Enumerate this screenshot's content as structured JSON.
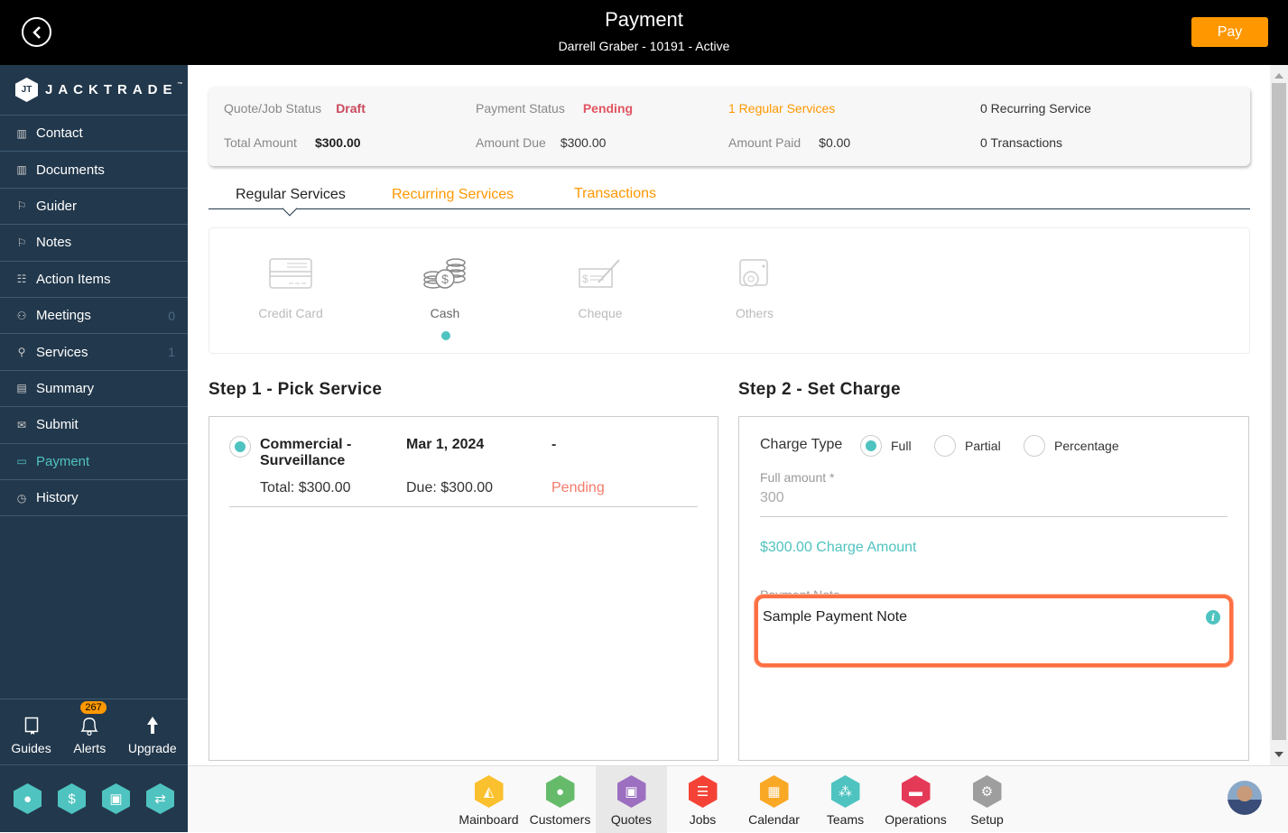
{
  "header": {
    "title": "Payment",
    "subtitle": "Darrell Graber - 10191 - Active",
    "pay_label": "Pay"
  },
  "brand": {
    "name": "JACKTRADE",
    "tm": "™"
  },
  "sidebar": {
    "items": [
      {
        "label": "Contact",
        "icon": "contact-book-icon"
      },
      {
        "label": "Documents",
        "icon": "document-book-icon"
      },
      {
        "label": "Guider",
        "icon": "signpost-icon"
      },
      {
        "label": "Notes",
        "icon": "signpost-icon"
      },
      {
        "label": "Action Items",
        "icon": "clipboard-icon"
      },
      {
        "label": "Meetings",
        "icon": "meeting-icon",
        "count": "0"
      },
      {
        "label": "Services",
        "icon": "services-icon",
        "count": "1"
      },
      {
        "label": "Summary",
        "icon": "summary-icon"
      },
      {
        "label": "Submit",
        "icon": "submit-icon"
      },
      {
        "label": "Payment",
        "icon": "payment-icon",
        "active": true
      },
      {
        "label": "History",
        "icon": "history-icon"
      }
    ],
    "tools": [
      {
        "label": "Guides"
      },
      {
        "label": "Alerts",
        "badge": "267"
      },
      {
        "label": "Upgrade"
      }
    ]
  },
  "summary": {
    "quote_status_label": "Quote/Job Status",
    "quote_status": "Draft",
    "payment_status_label": "Payment Status",
    "payment_status": "Pending",
    "regular_services": "1 Regular Services",
    "recurring_service": "0 Recurring Service",
    "total_label": "Total Amount",
    "total": "$300.00",
    "due_label": "Amount Due",
    "due": "$300.00",
    "paid_label": "Amount Paid",
    "paid": "$0.00",
    "transactions": "0 Transactions"
  },
  "tabs": [
    {
      "label": "Regular Services",
      "active": true
    },
    {
      "label": "Recurring Services"
    },
    {
      "label": "Transactions"
    }
  ],
  "methods": [
    {
      "label": "Credit Card"
    },
    {
      "label": "Cash",
      "selected": true
    },
    {
      "label": "Cheque"
    },
    {
      "label": "Others"
    }
  ],
  "step1": {
    "title": "Step 1 - Pick Service",
    "service": {
      "name": "Commercial - Surveillance",
      "date": "Mar 1, 2024",
      "extra": "-",
      "total": "Total: $300.00",
      "due": "Due: $300.00",
      "status": "Pending"
    }
  },
  "step2": {
    "title": "Step 2 - Set Charge",
    "charge_type_label": "Charge Type",
    "options": [
      "Full",
      "Partial",
      "Percentage"
    ],
    "selected": "Full",
    "full_amount_label": "Full amount *",
    "full_amount_value": "300",
    "charge_amount": "$300.00 Charge Amount",
    "note_label": "Payment Note",
    "note_value": "Sample Payment Note"
  },
  "apps": [
    {
      "label": "Mainboard",
      "color": "#fbc02d"
    },
    {
      "label": "Customers",
      "color": "#66bb6a"
    },
    {
      "label": "Quotes",
      "color": "#9c6fc0",
      "active": true
    },
    {
      "label": "Jobs",
      "color": "#f44336"
    },
    {
      "label": "Calendar",
      "color": "#f9a825"
    },
    {
      "label": "Teams",
      "color": "#4fc3c0"
    },
    {
      "label": "Operations",
      "color": "#e53958"
    },
    {
      "label": "Setup",
      "color": "#9e9e9e"
    }
  ],
  "colors": {
    "accent": "#4fc3c0",
    "orange": "#ff9800",
    "sidebar": "#22384c",
    "draft": "#d9534f",
    "highlight": "#ff7043"
  }
}
